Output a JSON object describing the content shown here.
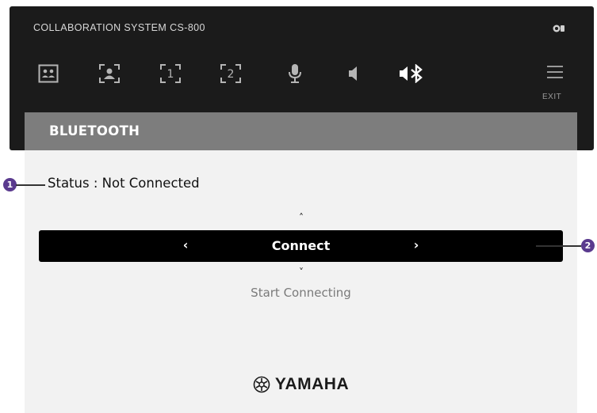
{
  "device": {
    "title": "COLLABORATION SYSTEM CS-800",
    "top_right_icon": "camera-status-icon",
    "toolbar": [
      {
        "icon": "multi-view-icon",
        "active": false
      },
      {
        "icon": "speaker-framing-icon",
        "active": false
      },
      {
        "icon": "preset-1-icon",
        "active": false
      },
      {
        "icon": "preset-2-icon",
        "active": false
      },
      {
        "icon": "microphone-icon",
        "active": false
      },
      {
        "icon": "speaker-volume-icon",
        "active": false
      },
      {
        "icon": "bluetooth-speaker-icon",
        "active": true
      },
      {
        "icon": "menu-icon",
        "active": false
      }
    ],
    "exit_label": "EXIT"
  },
  "panel": {
    "title": "BLUETOOTH",
    "status": "Status : Not Connected",
    "selector": {
      "value": "Connect",
      "prev_glyph": "‹",
      "next_glyph": "›",
      "up_glyph": "˄",
      "down_glyph": "˅"
    },
    "description": "Start Connecting",
    "brand": "YAMAHA"
  },
  "callouts": [
    {
      "number": "1",
      "target": "status"
    },
    {
      "number": "2",
      "target": "selector"
    }
  ],
  "colors": {
    "device_bg": "#1b1b1b",
    "header_bg": "#7d7d7d",
    "panel_bg": "#f2f2f2",
    "selector_bg": "#000000",
    "callout": "#5a3a8e",
    "icon_dim": "#b5b5b5",
    "icon_active": "#ffffff"
  }
}
